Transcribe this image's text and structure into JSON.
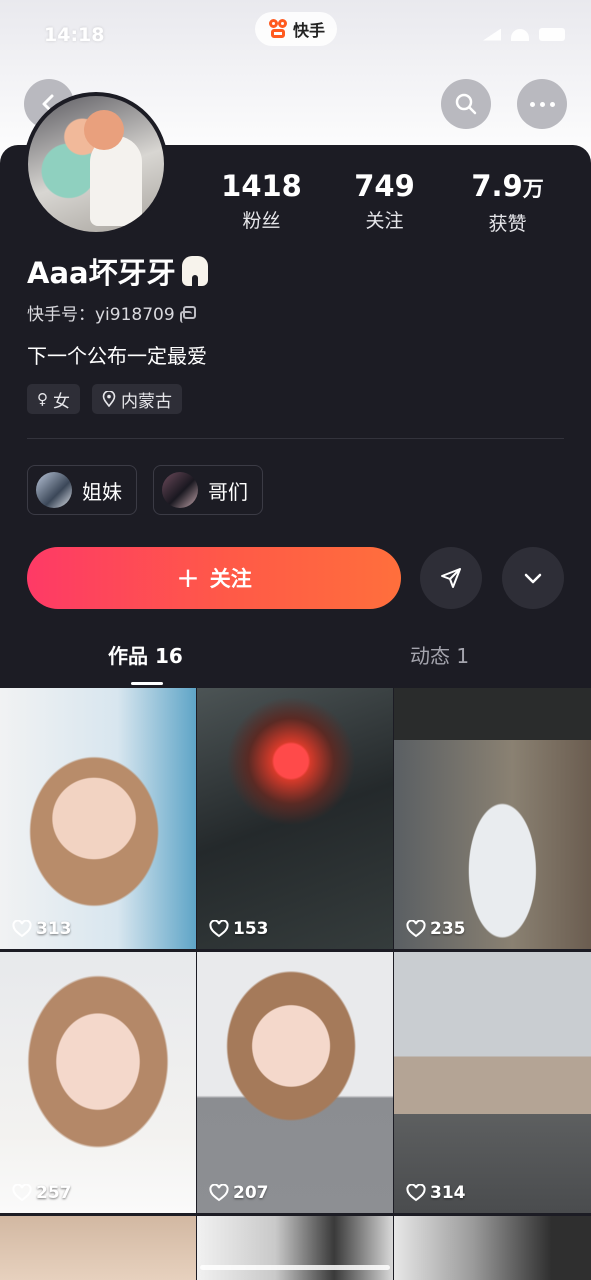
{
  "status_bar": {
    "time": "14:18"
  },
  "app": {
    "name": "快手"
  },
  "profile": {
    "stats": [
      {
        "value": "1418",
        "unit": "",
        "label": "粉丝"
      },
      {
        "value": "749",
        "unit": "",
        "label": "关注"
      },
      {
        "value": "7.9",
        "unit": "万",
        "label": "获赞"
      }
    ],
    "nickname": "Aaa坏牙牙",
    "user_id": "快手号：yi918709",
    "bio": "下一个公布一定最爱",
    "tags": [
      {
        "icon": "female-icon",
        "label": "女"
      },
      {
        "icon": "location-icon",
        "label": "内蒙古"
      }
    ],
    "groups": [
      {
        "label": "姐妹"
      },
      {
        "label": "哥们"
      }
    ]
  },
  "actions": {
    "follow_label": "关注",
    "follow_icon": "+"
  },
  "tabs": [
    {
      "label": "作品 16",
      "active": true
    },
    {
      "label": "动态 1",
      "active": false
    }
  ],
  "videos": [
    {
      "likes": "313"
    },
    {
      "likes": "153"
    },
    {
      "likes": "235"
    },
    {
      "likes": "257"
    },
    {
      "likes": "207"
    },
    {
      "likes": "314"
    }
  ],
  "colors": {
    "card_bg": "#1c1c24",
    "follow_gradient_start": "#fe3a66",
    "follow_gradient_end": "#ff6f3c",
    "app_accent": "#ff5a1f"
  }
}
